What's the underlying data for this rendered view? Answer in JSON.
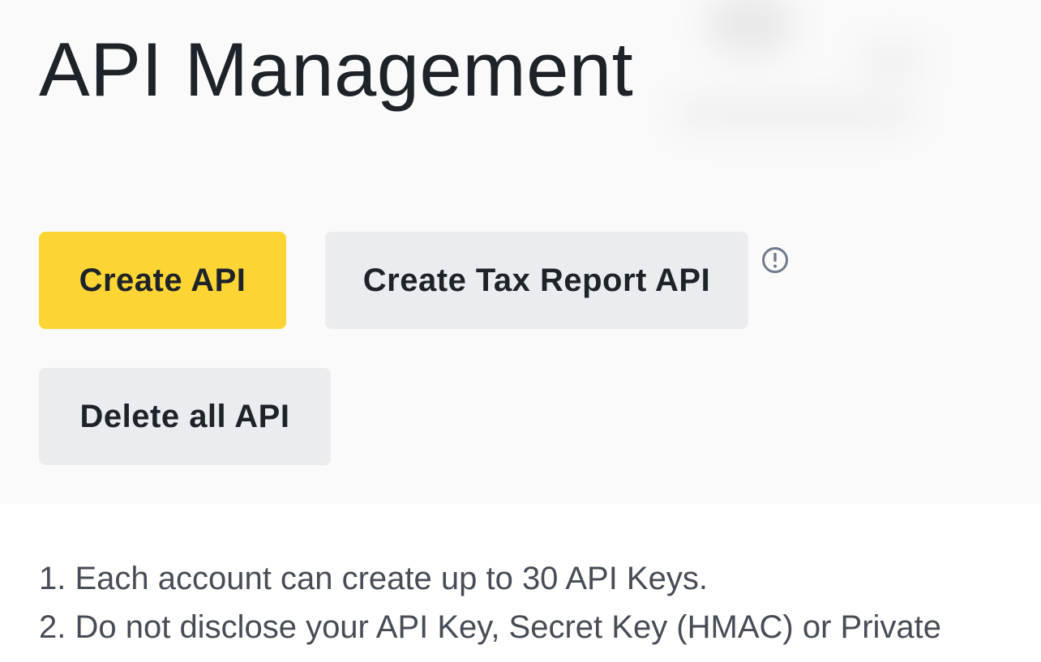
{
  "header": {
    "title": "API Management"
  },
  "actions": {
    "create_api_label": "Create API",
    "create_tax_report_api_label": "Create Tax Report API",
    "delete_all_api_label": "Delete all API",
    "info_icon": "exclamation-circle-icon"
  },
  "notes": {
    "items": [
      "1. Each account can create up to 30 API Keys.",
      "2. Do not disclose your API Key, Secret Key (HMAC) or Private"
    ]
  },
  "colors": {
    "primary_button": "#fcd535",
    "secondary_button": "#eaecef",
    "text_primary": "#1e2329",
    "text_secondary": "#474d57",
    "header_background": "#fafafa",
    "icon_gray": "#707a8a"
  }
}
